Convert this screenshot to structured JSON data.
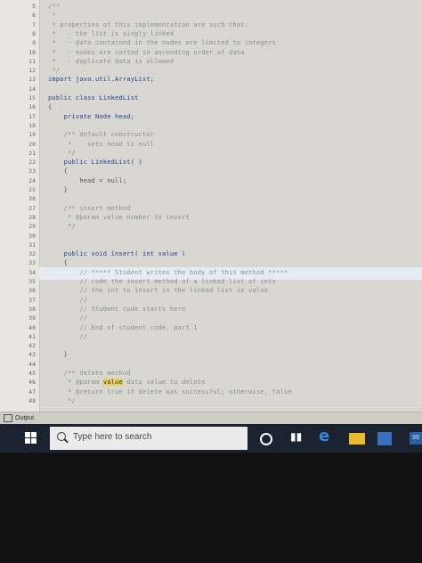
{
  "editor": {
    "lines": [
      {
        "n": "5",
        "text": "/**"
      },
      {
        "n": "6",
        "text": " *"
      },
      {
        "n": "7",
        "text": " * properties of this implementation are such that:"
      },
      {
        "n": "8",
        "text": " *   - the list is singly linked"
      },
      {
        "n": "9",
        "text": " *   - data contained in the nodes are limited to integers"
      },
      {
        "n": "10",
        "text": " *   - nodes are sorted in ascending order of data"
      },
      {
        "n": "11",
        "text": " *   - duplicate data is allowed"
      },
      {
        "n": "12",
        "text": " */"
      },
      {
        "n": "13",
        "text": "import java.util.ArrayList;"
      },
      {
        "n": "14",
        "text": ""
      },
      {
        "n": "15",
        "text": "public class LinkedList"
      },
      {
        "n": "16",
        "text": "{"
      },
      {
        "n": "17",
        "text": "    private Node head;"
      },
      {
        "n": "18",
        "text": ""
      },
      {
        "n": "19",
        "text": "    /** default constructor"
      },
      {
        "n": "20",
        "text": "     *    sets head to null"
      },
      {
        "n": "21",
        "text": "     */"
      },
      {
        "n": "22",
        "text": "    public LinkedList( )"
      },
      {
        "n": "23",
        "text": "    {"
      },
      {
        "n": "24",
        "text": "        head = null;"
      },
      {
        "n": "25",
        "text": "    }"
      },
      {
        "n": "26",
        "text": ""
      },
      {
        "n": "27",
        "text": "    /** insert method"
      },
      {
        "n": "28",
        "text": "     * @param value number to insert"
      },
      {
        "n": "29",
        "text": "     */"
      },
      {
        "n": "30",
        "text": ""
      },
      {
        "n": "31",
        "text": ""
      },
      {
        "n": "32",
        "text": "    public void insert( int value )"
      },
      {
        "n": "33",
        "text": "    {"
      },
      {
        "n": "34",
        "text": "        // ***** Student writes the body of this method *****"
      },
      {
        "n": "35",
        "text": "        // code the insert method of a linked list of ints"
      },
      {
        "n": "36",
        "text": "        // the int to insert in the linked list is value"
      },
      {
        "n": "37",
        "text": "        //"
      },
      {
        "n": "38",
        "text": "        // Student code starts here"
      },
      {
        "n": "39",
        "text": "        //"
      },
      {
        "n": "40",
        "text": "        // End of student code, part 1"
      },
      {
        "n": "41",
        "text": "        //"
      },
      {
        "n": "42",
        "text": ""
      },
      {
        "n": "43",
        "text": "    }"
      },
      {
        "n": "44",
        "text": ""
      },
      {
        "n": "45",
        "text": "    /** delete method"
      },
      {
        "n": "46",
        "text": "     * @param value data value to delete"
      },
      {
        "n": "47",
        "text": "     * @return true if delete was successful; otherwise, false"
      },
      {
        "n": "48",
        "text": "     */"
      }
    ]
  },
  "output_panel": {
    "label": "Output"
  },
  "taskbar": {
    "search_placeholder": "Type here to search",
    "badge": "99"
  }
}
